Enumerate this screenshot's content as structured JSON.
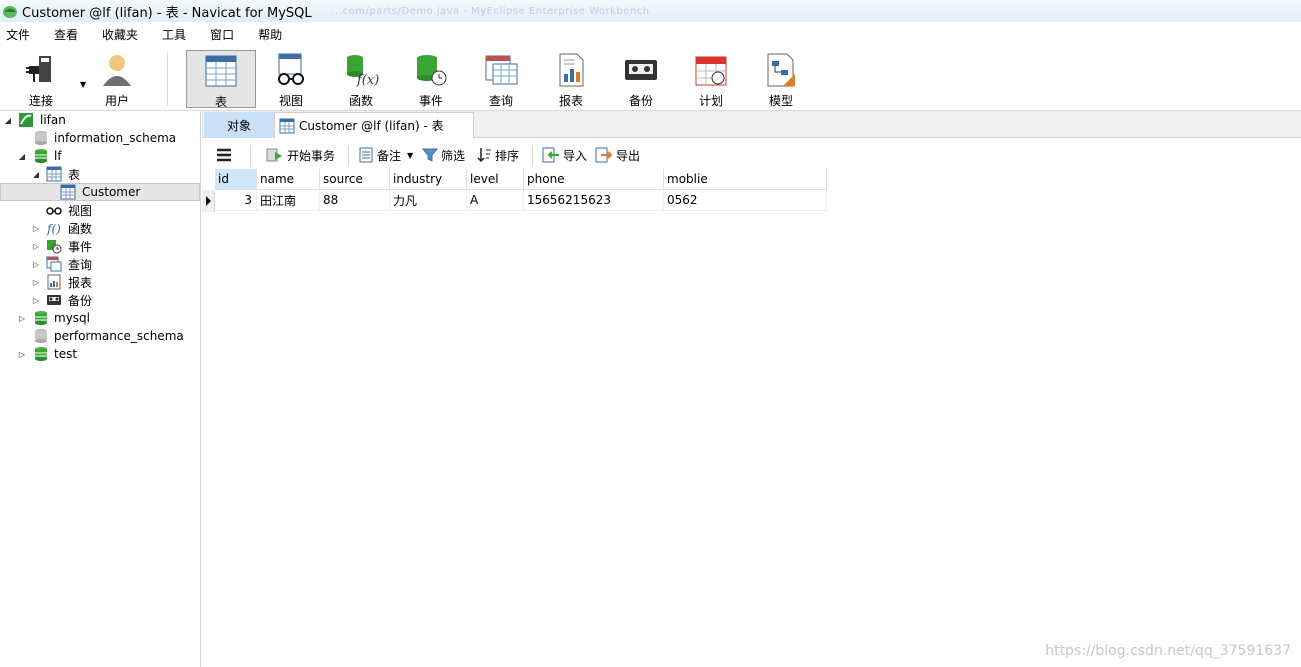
{
  "window": {
    "title": "Customer @lf (lifan) - 表 - Navicat for MySQL",
    "ghost_text": "...com/parts/Demo.java - MyEclipse Enterprise Workbench"
  },
  "menu": [
    "文件",
    "查看",
    "收藏夹",
    "工具",
    "窗口",
    "帮助"
  ],
  "toolbar": {
    "connect": "连接",
    "user": "用户",
    "table": "表",
    "view": "视图",
    "function": "函数",
    "event": "事件",
    "query": "查询",
    "report": "报表",
    "backup": "备份",
    "schedule": "计划",
    "model": "模型"
  },
  "tree": {
    "connection": "lifan",
    "databases": {
      "information_schema": "information_schema",
      "lf": "lf",
      "mysql": "mysql",
      "performance_schema": "performance_schema",
      "test": "test"
    },
    "lf_children": {
      "tables": "表",
      "customer": "Customer",
      "views": "视图",
      "functions": "函数",
      "events": "事件",
      "queries": "查询",
      "reports": "报表",
      "backups": "备份"
    }
  },
  "tabs": {
    "objects": "对象",
    "active": "Customer @lf (lifan) - 表"
  },
  "subtoolbar": {
    "begin_transaction": "开始事务",
    "memo": "备注",
    "filter": "筛选",
    "sort": "排序",
    "import": "导入",
    "export": "导出"
  },
  "table": {
    "columns": [
      "id",
      "name",
      "source",
      "industry",
      "level",
      "phone",
      "moblie"
    ],
    "rows": [
      [
        "3",
        "田江南",
        "88",
        "力凡",
        "A",
        "15656215623",
        "0562"
      ]
    ]
  },
  "watermark": "https://blog.csdn.net/qq_37591637",
  "colors": {
    "tab_objects_bg": "#c9e0f7",
    "db_icon_green": "#3aa535",
    "header_selected": "#cfe8f8"
  }
}
